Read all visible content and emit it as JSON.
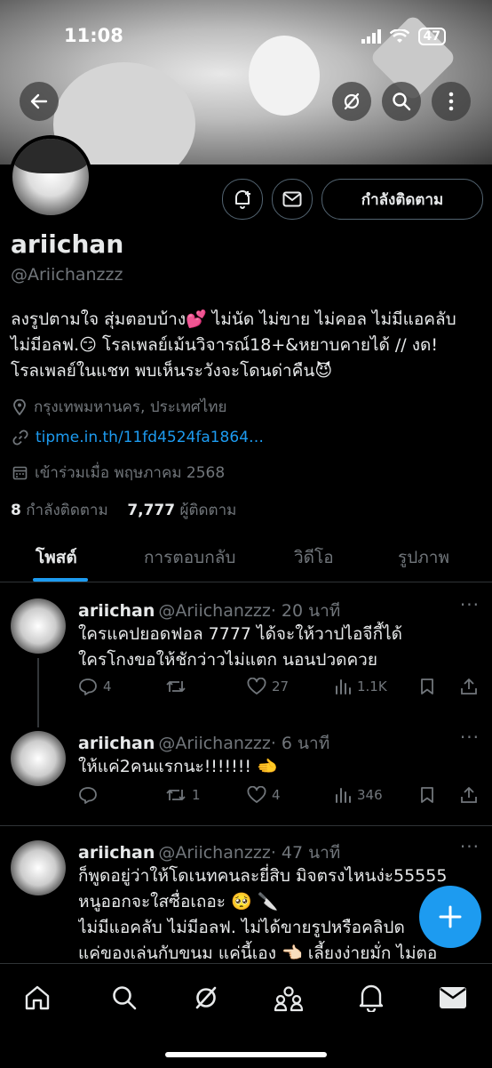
{
  "status_bar": {
    "time": "11:08",
    "battery": "47"
  },
  "profile": {
    "name": "ariichan",
    "handle": "@Ariichanzzz",
    "bio_lines": [
      "ลงรูปตามใจ สุ่มตอบบ้าง💕 ไม่นัด ไม่ขาย ไม่คอล ไม่มีแอคลับ",
      "ไม่มีอลฟ.😏 โรลเพลย์เม้นวิจารณ์18+&หยาบคายได้ // งด!",
      "โรลเพลย์ในแชท พบเห็นระวังจะโดนด่าคืน😈"
    ],
    "location": "กรุงเทพมหานคร, ประเทศไทย",
    "link": "tipme.in.th/11fd4524fa1864…",
    "joined": "เข้าร่วมเมื่อ พฤษภาคม 2568",
    "following_count": "8",
    "following_label": "กำลังติดตาม",
    "followers_count": "7,777",
    "followers_label": "ผู้ติดตาม",
    "follow_button": "กำลังติดตาม"
  },
  "tabs": [
    "โพสต์",
    "การตอบกลับ",
    "วิดีโอ",
    "รูปภาพ"
  ],
  "posts": [
    {
      "name": "ariichan",
      "handle": "@Ariichanzzz",
      "time": "· 20 นาที",
      "lines": [
        "ใครแคปยอดฟอล 7777 ได้จะให้วาปไอจีกี้ได้",
        "ใครโกงขอให้ชักว่าวไม่แตก นอนปวดควย"
      ],
      "replies": "4",
      "reposts": "",
      "likes": "27",
      "views": "1.1K"
    },
    {
      "name": "ariichan",
      "handle": "@Ariichanzzz",
      "time": "· 6 นาที",
      "lines": [
        "ให้แค่2คนแรกนะ!!!!!!!  🫲"
      ],
      "replies": "",
      "reposts": "1",
      "likes": "4",
      "views": "346"
    },
    {
      "name": "ariichan",
      "handle": "@Ariichanzzz",
      "time": "· 47 นาที",
      "lines": [
        "ก็พูดอยู่ว่าให้โดเนทคนละยี่สิบ มิจตรงไหนง่ะ55555",
        "หนูออกจะใสซื่อเถอะ 🥺 🔪",
        "ไม่มีแอคลับ ไม่มีอลฟ. ไม่ได้ขายรูปหรือคลิปด",
        "แค่ของเล่นกับขนม แค่นี้เอง 👈🏻 เลี้ยงง่ายมั่ก ไม่ตอ"
      ]
    }
  ],
  "colors": {
    "accent": "#1d9bf0",
    "muted": "#71767b",
    "text": "#e7e9ea",
    "bg": "#000000"
  }
}
